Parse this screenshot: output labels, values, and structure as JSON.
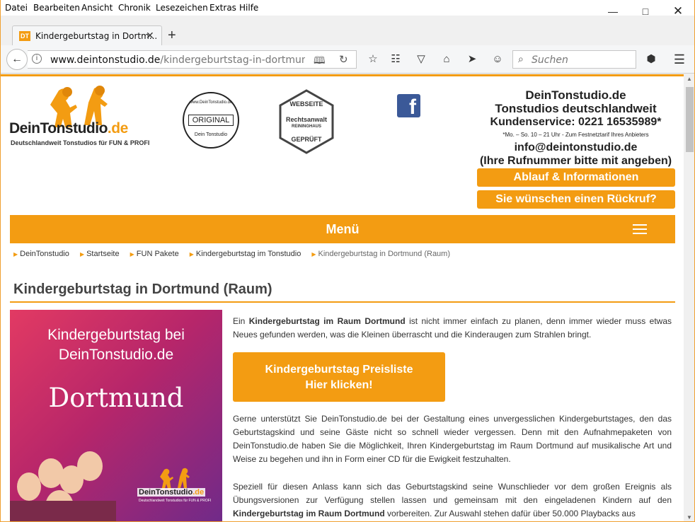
{
  "menubar": {
    "items": [
      "Datei",
      "Bearbeiten",
      "Ansicht",
      "Chronik",
      "Lesezeichen",
      "Extras",
      "Hilfe"
    ]
  },
  "tab": {
    "favicon_text": "DT",
    "title": "Kindergeburtstag in Dortm..."
  },
  "urlbar": {
    "domain": "www.deintonstudio.de",
    "path": "/kindergeburtstag-in-dortmund.htm"
  },
  "search": {
    "placeholder": "Suchen"
  },
  "header": {
    "logo_brand_1": "DeinTonstudio",
    "logo_brand_2": ".de",
    "logo_tagline": "Deutschlandweit Tonstudios für FUN & PROFI",
    "seal_original": {
      "top": "www.DeinTonstudio.de",
      "mid": "ORIGINAL",
      "bottom": "Dein Tonstudio"
    },
    "seal_legal": {
      "l1": "WEBSEITE",
      "l2": "Rechtsanwalt",
      "l3": "REININGHAUS",
      "l4": "GEPRÜFT"
    },
    "contact": {
      "name": "DeinTonstudio.de",
      "subtitle": "Tonstudios deutschlandweit",
      "service": "Kundenservice: 0221 16535989*",
      "hours": "*Mo. – So. 10 – 21 Uhr - Zum Festnetztarif Ihres Anbieters",
      "email": "info@deintonstudio.de",
      "note": "(Ihre Rufnummer bitte mit angeben)"
    },
    "btn_info": "Ablauf & Informationen",
    "btn_callback": "Sie wünschen einen Rückruf?"
  },
  "menu": {
    "label": "Menü"
  },
  "breadcrumbs": [
    "DeinTonstudio",
    "Startseite",
    "FUN Pakete",
    "Kindergeburtstag im Tonstudio",
    "Kindergeburtstag in Dortmund (Raum)"
  ],
  "page": {
    "title": "Kindergeburtstag in Dortmund (Raum)",
    "hero_line1": "Kindergeburtstag bei",
    "hero_line2": "DeinTonstudio.de",
    "hero_city": "Dortmund",
    "hero_logo_1": "DeinTonstudio",
    "hero_logo_2": ".de",
    "hero_logo_tag": "Deutschlandweit Tonstudios für FUN & PROFI",
    "intro_pre": "Ein ",
    "intro_bold": "Kindergeburtstag im Raum Dortmund",
    "intro_post": " ist nicht immer einfach zu planen, denn immer wieder muss etwas Neues gefunden werden, was die Kleinen überrascht und die Kinderaugen zum Strahlen bringt.",
    "cta_line1": "Kindergeburtstag Preisliste",
    "cta_line2": "Hier klicken!",
    "para2": "Gerne unterstützt Sie DeinTonstudio.de bei der Gestaltung eines unvergesslichen Kindergeburtstages, den das Geburtstagskind und seine Gäste nicht so schnell wieder vergessen. Denn mit den Aufnahmepaketen von DeinTonstudio.de haben Sie die Möglichkeit, Ihren Kindergeburtstag im Raum Dortmund auf musikalische Art und Weise zu begehen und ihn in Form einer CD für die Ewigkeit festzuhalten.",
    "para3_pre": "Speziell für diesen Anlass kann sich das Geburtstagskind seine Wunschlieder vor dem großen Ereignis als Übungsversionen zur Verfügung stellen lassen und gemeinsam mit den eingeladenen Kindern auf den ",
    "para3_bold": "Kindergeburtstag im Raum Dortmund",
    "para3_post": " vorbereiten. Zur Auswahl stehen dafür über 50.000 Playbacks aus"
  },
  "colors": {
    "accent": "#f39c12",
    "facebook": "#3b5998"
  }
}
